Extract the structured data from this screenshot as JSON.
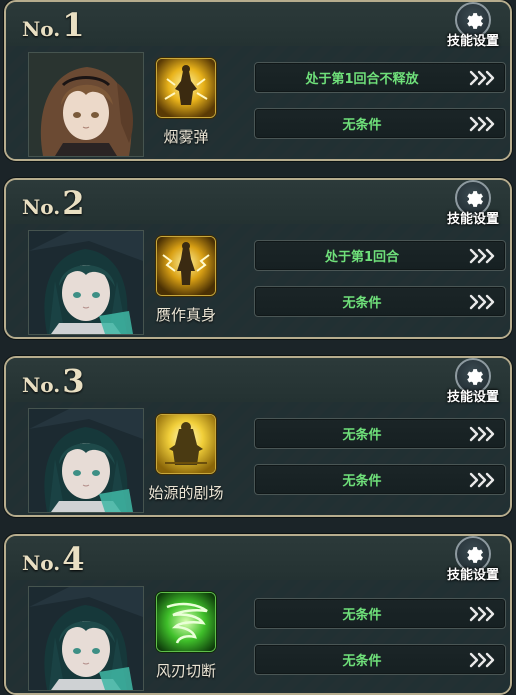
{
  "slots": [
    {
      "no_prefix": "No.",
      "number": "1",
      "character": "brown-haired-girl",
      "skill_icon": "smoke-bomb-icon",
      "skill_name": "烟雾弹",
      "conditions": [
        "处于第1回合不释放",
        "无条件"
      ],
      "settings_label": "技能设置"
    },
    {
      "no_prefix": "No.",
      "number": "2",
      "character": "teal-haired-girl",
      "skill_icon": "figure-lightning-icon",
      "skill_name": "赝作真身",
      "conditions": [
        "处于第1回合",
        "无条件"
      ],
      "settings_label": "技能设置"
    },
    {
      "no_prefix": "No.",
      "number": "3",
      "character": "teal-haired-girl",
      "skill_icon": "theater-figure-icon",
      "skill_name": "始源的剧场",
      "conditions": [
        "无条件",
        "无条件"
      ],
      "settings_label": "技能设置"
    },
    {
      "no_prefix": "No.",
      "number": "4",
      "character": "teal-haired-girl",
      "skill_icon": "wind-blade-icon",
      "skill_name": "风刃切断",
      "conditions": [
        "无条件",
        "无条件"
      ],
      "settings_label": "技能设置"
    }
  ],
  "colors": {
    "condition_text": "#6fe07a",
    "frame_gold": "#b7ad8e",
    "label_cream": "#e9dfc2"
  }
}
